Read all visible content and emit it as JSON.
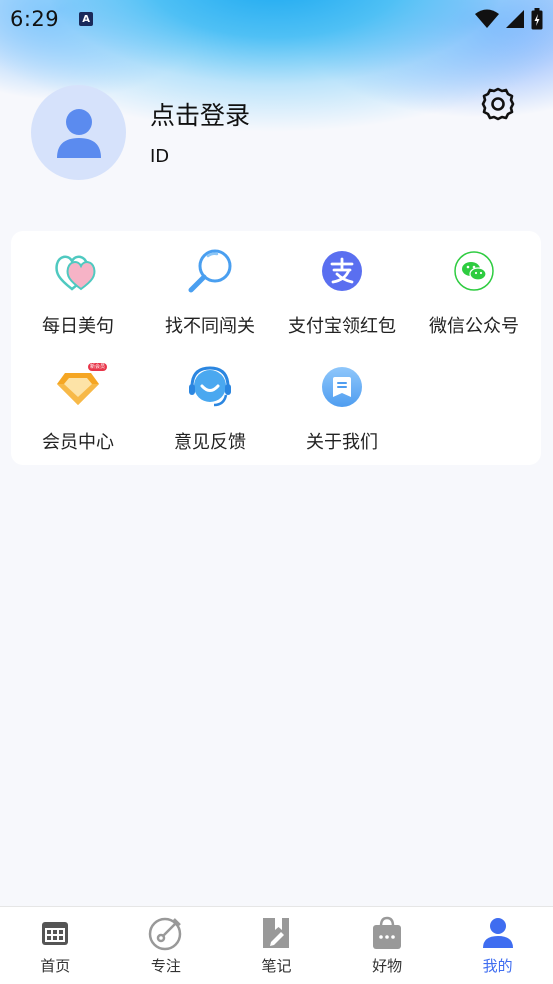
{
  "status_bar": {
    "time": "6:29",
    "notif_icon": "A"
  },
  "profile": {
    "login_text": "点击登录",
    "id_text": "ID"
  },
  "features": [
    {
      "label": "每日美句",
      "icon": "hearts-icon"
    },
    {
      "label": "找不同闯关",
      "icon": "magnifier-icon"
    },
    {
      "label": "支付宝领红包",
      "icon": "alipay-icon"
    },
    {
      "label": "微信公众号",
      "icon": "wechat-icon"
    },
    {
      "label": "会员中心",
      "icon": "diamond-icon",
      "badge": "新会员"
    },
    {
      "label": "意见反馈",
      "icon": "headset-icon"
    },
    {
      "label": "关于我们",
      "icon": "about-icon"
    }
  ],
  "tabs": [
    {
      "label": "首页",
      "icon": "calendar-icon"
    },
    {
      "label": "专注",
      "icon": "timer-icon"
    },
    {
      "label": "笔记",
      "icon": "notebook-icon"
    },
    {
      "label": "好物",
      "icon": "shopping-bag-icon"
    },
    {
      "label": "我的",
      "icon": "person-icon",
      "active": true
    }
  ],
  "colors": {
    "accent": "#3f6df0",
    "background": "#f7f8fc",
    "alipay": "#5a6ff0",
    "wechat": "#2ecc40",
    "diamond": "#f5a623"
  }
}
